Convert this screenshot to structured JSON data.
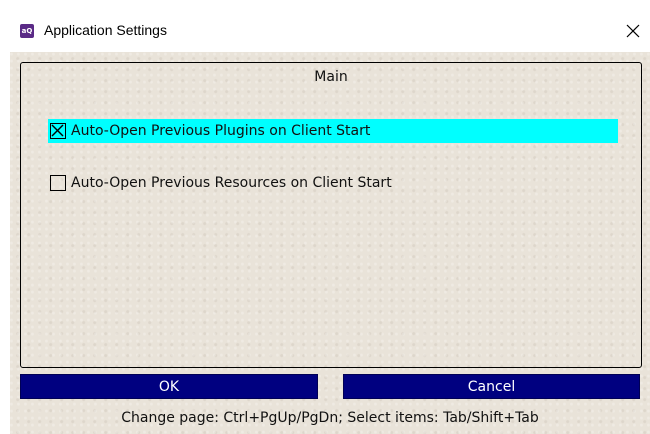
{
  "window": {
    "title": "Application Settings",
    "app_icon": "app-logo-icon",
    "app_icon_text": "aQ",
    "close_icon": "close-icon"
  },
  "panel": {
    "title": "Main",
    "options": [
      {
        "label": "Auto-Open Previous Plugins on Client Start",
        "checked": true,
        "focused": true
      },
      {
        "label": "Auto-Open Previous Resources on Client Start",
        "checked": false,
        "focused": false
      }
    ]
  },
  "buttons": {
    "ok": "OK",
    "cancel": "Cancel"
  },
  "hint": "Change page: Ctrl+PgUp/PgDn; Select items: Tab/Shift+Tab",
  "colors": {
    "background": "#e9e3d9",
    "focus_highlight": "#00ffff",
    "button": "#000080",
    "app_icon": "#5a2a86"
  }
}
